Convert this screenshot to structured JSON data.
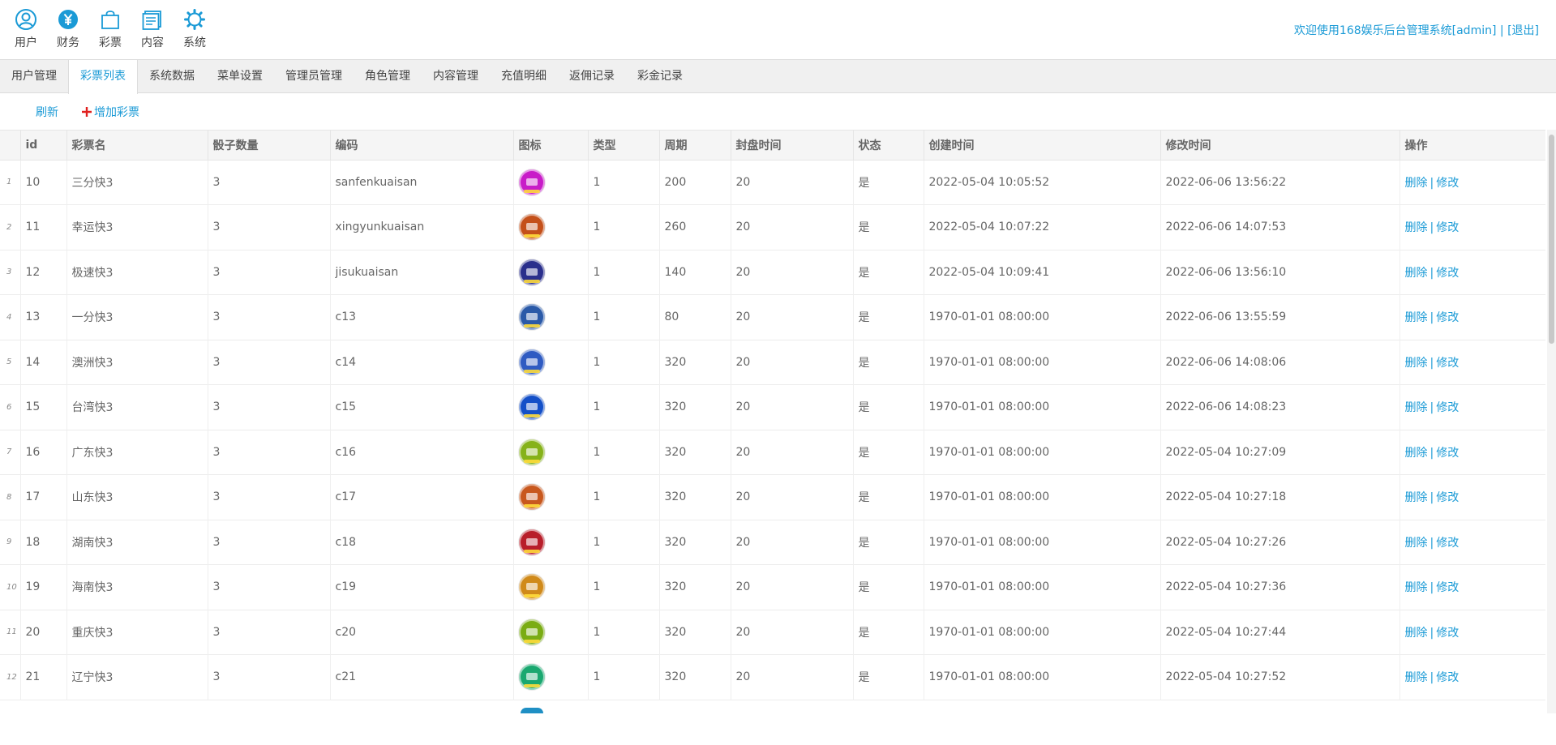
{
  "top_nav": [
    {
      "label": "用户",
      "icon": "user-icon"
    },
    {
      "label": "财务",
      "icon": "yen-icon"
    },
    {
      "label": "彩票",
      "icon": "bag-icon"
    },
    {
      "label": "内容",
      "icon": "content-icon"
    },
    {
      "label": "系统",
      "icon": "gear-icon"
    }
  ],
  "header": {
    "welcome": "欢迎使用168娱乐后台管理系统[admin]",
    "separator": "|",
    "logout": "[退出]"
  },
  "tabs": [
    {
      "label": "用户管理",
      "active": false
    },
    {
      "label": "彩票列表",
      "active": true
    },
    {
      "label": "系统数据",
      "active": false
    },
    {
      "label": "菜单设置",
      "active": false
    },
    {
      "label": "管理员管理",
      "active": false
    },
    {
      "label": "角色管理",
      "active": false
    },
    {
      "label": "内容管理",
      "active": false
    },
    {
      "label": "充值明细",
      "active": false
    },
    {
      "label": "返佣记录",
      "active": false
    },
    {
      "label": "彩金记录",
      "active": false
    }
  ],
  "toolbar": {
    "refresh_label": "刷新",
    "add_label": "增加彩票"
  },
  "table": {
    "columns": [
      "id",
      "彩票名",
      "骰子数量",
      "编码",
      "图标",
      "类型",
      "周期",
      "封盘时间",
      "状态",
      "创建时间",
      "修改时间",
      "操作"
    ],
    "delete_label": "删除",
    "edit_label": "修改",
    "op_separator": "|",
    "rows": [
      {
        "n": "1",
        "id": "10",
        "name": "三分快3",
        "dice": "3",
        "code": "sanfenkuaisan",
        "icon_color": "#c81cc8",
        "type": "1",
        "period": "200",
        "close": "20",
        "status": "是",
        "created": "2022-05-04 10:05:52",
        "modified": "2022-06-06 13:56:22"
      },
      {
        "n": "2",
        "id": "11",
        "name": "幸运快3",
        "dice": "3",
        "code": "xingyunkuaisan",
        "icon_color": "#c4501a",
        "type": "1",
        "period": "260",
        "close": "20",
        "status": "是",
        "created": "2022-05-04 10:07:22",
        "modified": "2022-06-06 14:07:53"
      },
      {
        "n": "3",
        "id": "12",
        "name": "极速快3",
        "dice": "3",
        "code": "jisukuaisan",
        "icon_color": "#2a2f8c",
        "type": "1",
        "period": "140",
        "close": "20",
        "status": "是",
        "created": "2022-05-04 10:09:41",
        "modified": "2022-06-06 13:56:10"
      },
      {
        "n": "4",
        "id": "13",
        "name": "一分快3",
        "dice": "3",
        "code": "c13",
        "icon_color": "#2b5aa8",
        "type": "1",
        "period": "80",
        "close": "20",
        "status": "是",
        "created": "1970-01-01 08:00:00",
        "modified": "2022-06-06 13:55:59"
      },
      {
        "n": "5",
        "id": "14",
        "name": "澳洲快3",
        "dice": "3",
        "code": "c14",
        "icon_color": "#2f5bc2",
        "type": "1",
        "period": "320",
        "close": "20",
        "status": "是",
        "created": "1970-01-01 08:00:00",
        "modified": "2022-06-06 14:08:06"
      },
      {
        "n": "6",
        "id": "15",
        "name": "台湾快3",
        "dice": "3",
        "code": "c15",
        "icon_color": "#1450c8",
        "type": "1",
        "period": "320",
        "close": "20",
        "status": "是",
        "created": "1970-01-01 08:00:00",
        "modified": "2022-06-06 14:08:23"
      },
      {
        "n": "7",
        "id": "16",
        "name": "广东快3",
        "dice": "3",
        "code": "c16",
        "icon_color": "#86b21a",
        "type": "1",
        "period": "320",
        "close": "20",
        "status": "是",
        "created": "1970-01-01 08:00:00",
        "modified": "2022-05-04 10:27:09"
      },
      {
        "n": "8",
        "id": "17",
        "name": "山东快3",
        "dice": "3",
        "code": "c17",
        "icon_color": "#c8581e",
        "type": "1",
        "period": "320",
        "close": "20",
        "status": "是",
        "created": "1970-01-01 08:00:00",
        "modified": "2022-05-04 10:27:18"
      },
      {
        "n": "9",
        "id": "18",
        "name": "湖南快3",
        "dice": "3",
        "code": "c18",
        "icon_color": "#b81e2a",
        "type": "1",
        "period": "320",
        "close": "20",
        "status": "是",
        "created": "1970-01-01 08:00:00",
        "modified": "2022-05-04 10:27:26"
      },
      {
        "n": "10",
        "id": "19",
        "name": "海南快3",
        "dice": "3",
        "code": "c19",
        "icon_color": "#d08a1a",
        "type": "1",
        "period": "320",
        "close": "20",
        "status": "是",
        "created": "1970-01-01 08:00:00",
        "modified": "2022-05-04 10:27:36"
      },
      {
        "n": "11",
        "id": "20",
        "name": "重庆快3",
        "dice": "3",
        "code": "c20",
        "icon_color": "#7aac14",
        "type": "1",
        "period": "320",
        "close": "20",
        "status": "是",
        "created": "1970-01-01 08:00:00",
        "modified": "2022-05-04 10:27:44"
      },
      {
        "n": "12",
        "id": "21",
        "name": "辽宁快3",
        "dice": "3",
        "code": "c21",
        "icon_color": "#1aa870",
        "type": "1",
        "period": "320",
        "close": "20",
        "status": "是",
        "created": "1970-01-01 08:00:00",
        "modified": "2022-05-04 10:27:52"
      }
    ]
  },
  "colors": {
    "accent": "#1a9ad6",
    "add_plus": "#e0201e"
  }
}
